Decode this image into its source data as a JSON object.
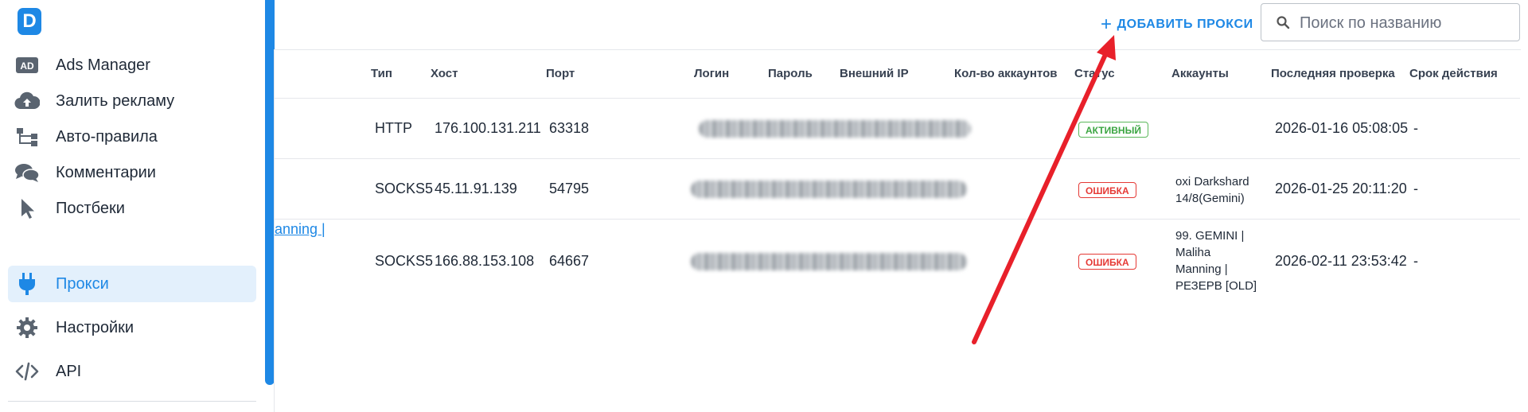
{
  "app": {
    "logo_letter": "D"
  },
  "sidebar": {
    "items": [
      {
        "label": "Ads Manager",
        "icon": "ad-icon"
      },
      {
        "label": "Залить рекламу",
        "icon": "cloud-upload-icon"
      },
      {
        "label": "Авто-правила",
        "icon": "hierarchy-icon"
      },
      {
        "label": "Комментарии",
        "icon": "comments-icon"
      },
      {
        "label": "Постбеки",
        "icon": "cursor-icon"
      },
      {
        "label": "Прокси",
        "icon": "plug-icon",
        "active": true
      },
      {
        "label": "Настройки",
        "icon": "gear-icon"
      },
      {
        "label": "API",
        "icon": "code-icon"
      }
    ]
  },
  "header": {
    "add_button": {
      "icon": "+",
      "label": "ДОБАВИТЬ ПРОКСИ"
    },
    "search": {
      "placeholder": "Поиск по названию",
      "value": ""
    }
  },
  "table": {
    "columns": [
      "Тип",
      "Хост",
      "Порт",
      "Логин",
      "Пароль",
      "Внешний IP",
      "Кол-во аккаунтов",
      "Статус",
      "Аккаунты",
      "Последняя проверка",
      "Срок действия"
    ],
    "truncated_link": "anning |",
    "rows": [
      {
        "type": "HTTP",
        "host": "176.100.131.211",
        "port": "63318",
        "status": "АКТИВНЫЙ",
        "status_kind": "ok",
        "accounts": "",
        "last_check": "2026-01-16 05:08:05",
        "expiry": "-"
      },
      {
        "type": "SOCKS5",
        "host": "45.11.91.139",
        "port": "54795",
        "status": "ОШИБКА",
        "status_kind": "err",
        "accounts": "oxi Darkshard 14/8(Gemini)",
        "last_check": "2026-01-25 20:11:20",
        "expiry": "-"
      },
      {
        "type": "SOCKS5",
        "host": "166.88.153.108",
        "port": "64667",
        "status": "ОШИБКА",
        "status_kind": "err",
        "accounts": "99. GEMINI | Maliha Manning | РЕЗЕРВ [OLD]",
        "last_check": "2026-02-11 23:53:42",
        "expiry": "-"
      }
    ]
  },
  "colors": {
    "accent": "#1e88e5",
    "active_bg": "#e3f0fc",
    "ok": "#3aa541",
    "error": "#e53935",
    "annotation_arrow": "#e8202a"
  }
}
